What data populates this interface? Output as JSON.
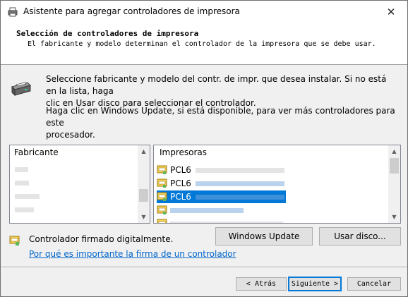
{
  "window": {
    "title": "Asistente para agregar controladores de impresora",
    "close_glyph": "✕"
  },
  "header": {
    "title": "Selección de controladores de impresora",
    "subtitle": "El fabricante y modelo determinan el controlador de la impresora que se debe usar."
  },
  "instructions": {
    "line1": "Seleccione fabricante y modelo del contr. de impr. que desea instalar. Si no está en la lista, haga",
    "line2": "clic en Usar disco para seleccionar el controlador.",
    "line3": "Haga clic en Windows Update, si está disponible, para ver más controladores para este",
    "line4": "procesador."
  },
  "manufacturer_list": {
    "header": "Fabricante"
  },
  "printer_list": {
    "header": "Impresoras",
    "items": [
      {
        "label": "PCL6",
        "selected": false
      },
      {
        "label": "PCL6",
        "selected": false
      },
      {
        "label": "PCL6",
        "selected": true
      },
      {
        "label": "",
        "selected": false
      },
      {
        "label": "",
        "selected": false
      }
    ]
  },
  "buttons": {
    "windows_update": "Windows Update",
    "have_disk": "Usar disco...",
    "back": "< Atrás",
    "next": "Siguiente >",
    "cancel": "Cancelar"
  },
  "signature": {
    "label": "Controlador firmado digitalmente.",
    "link": "Por qué es importante la firma de un controlador"
  },
  "icons": {
    "title": "printer-icon",
    "close": "close-icon",
    "wizard": "printer-icon",
    "driver": "driver-certificate-icon",
    "scroll_up": "chevron-up-icon",
    "scroll_down": "chevron-down-icon"
  },
  "colors": {
    "selection": "#0078d7",
    "link": "#0066cc",
    "default_button_border": "#0078d7"
  }
}
